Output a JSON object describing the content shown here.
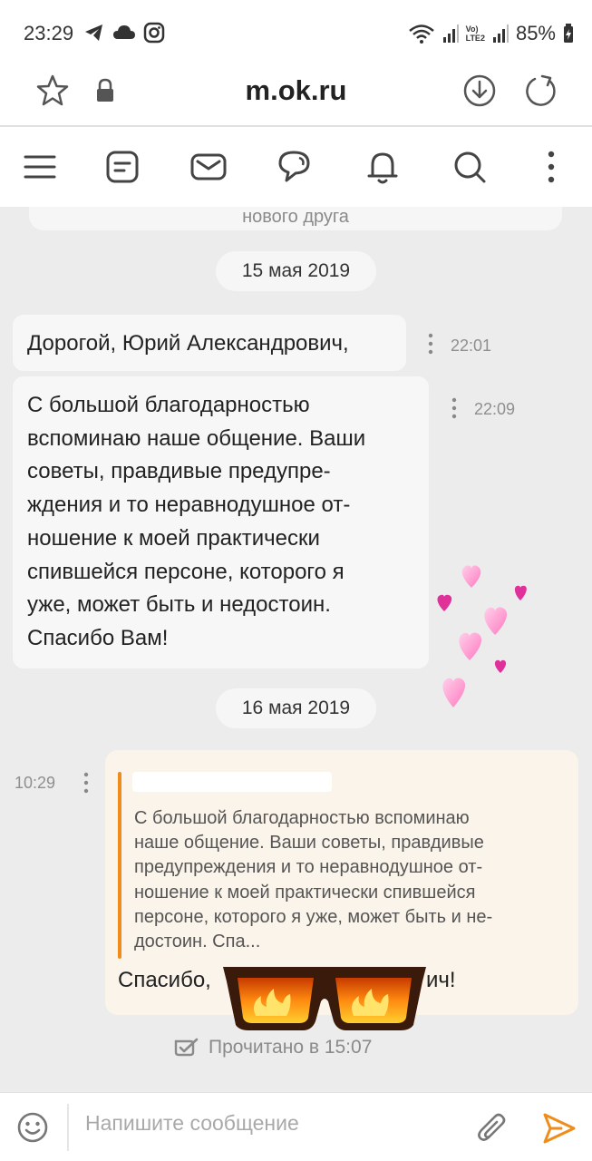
{
  "status_bar": {
    "time": "23:29",
    "battery_percent": "85%",
    "network_label_line1": "Vo)",
    "network_label_line2": "LTE2"
  },
  "browser": {
    "url": "m.ok.ru"
  },
  "nav_icons": [
    "menu-icon",
    "feed-icon",
    "mail-icon",
    "chat-icon",
    "bell-icon",
    "search-icon",
    "more-vertical-icon"
  ],
  "chat": {
    "previous_snippet": "нового друга",
    "date_1": "15 мая 2019",
    "message_1": {
      "text": "Дорогой, Юрий Александрович,",
      "time": "22:01"
    },
    "message_2": {
      "lines": [
        "С большой благодарностью",
        "вспоминаю наше общение. Ваши",
        "советы, правдивые предупре-",
        "ждения и то неравнодушное от-",
        "ношение к моей практически",
        "спившейся персоне, которого я",
        "уже, может быть и недостоин.",
        "Спасибо Вам!"
      ],
      "time": "22:09"
    },
    "date_2": "16 мая 2019",
    "reply": {
      "time": "10:29",
      "quote_lines": [
        "С большой благодарностью вспоминаю",
        "наше общение. Ваши советы, правдивые",
        "предупреждения и то неравнодушное от-",
        "ношение к моей практически спившейся",
        "персоне, которого я уже, может быть и не-",
        "достоин. Спа..."
      ],
      "text_start": "Спасибо,",
      "text_end": "ич!"
    },
    "read_status": "Прочитано в 15:07"
  },
  "composer": {
    "placeholder": "Напишите сообщение"
  },
  "colors": {
    "accent": "#f08c1a",
    "chat_bg": "#ececec",
    "bubble_in": "#f7f7f7",
    "bubble_out": "#fbf4ea"
  }
}
